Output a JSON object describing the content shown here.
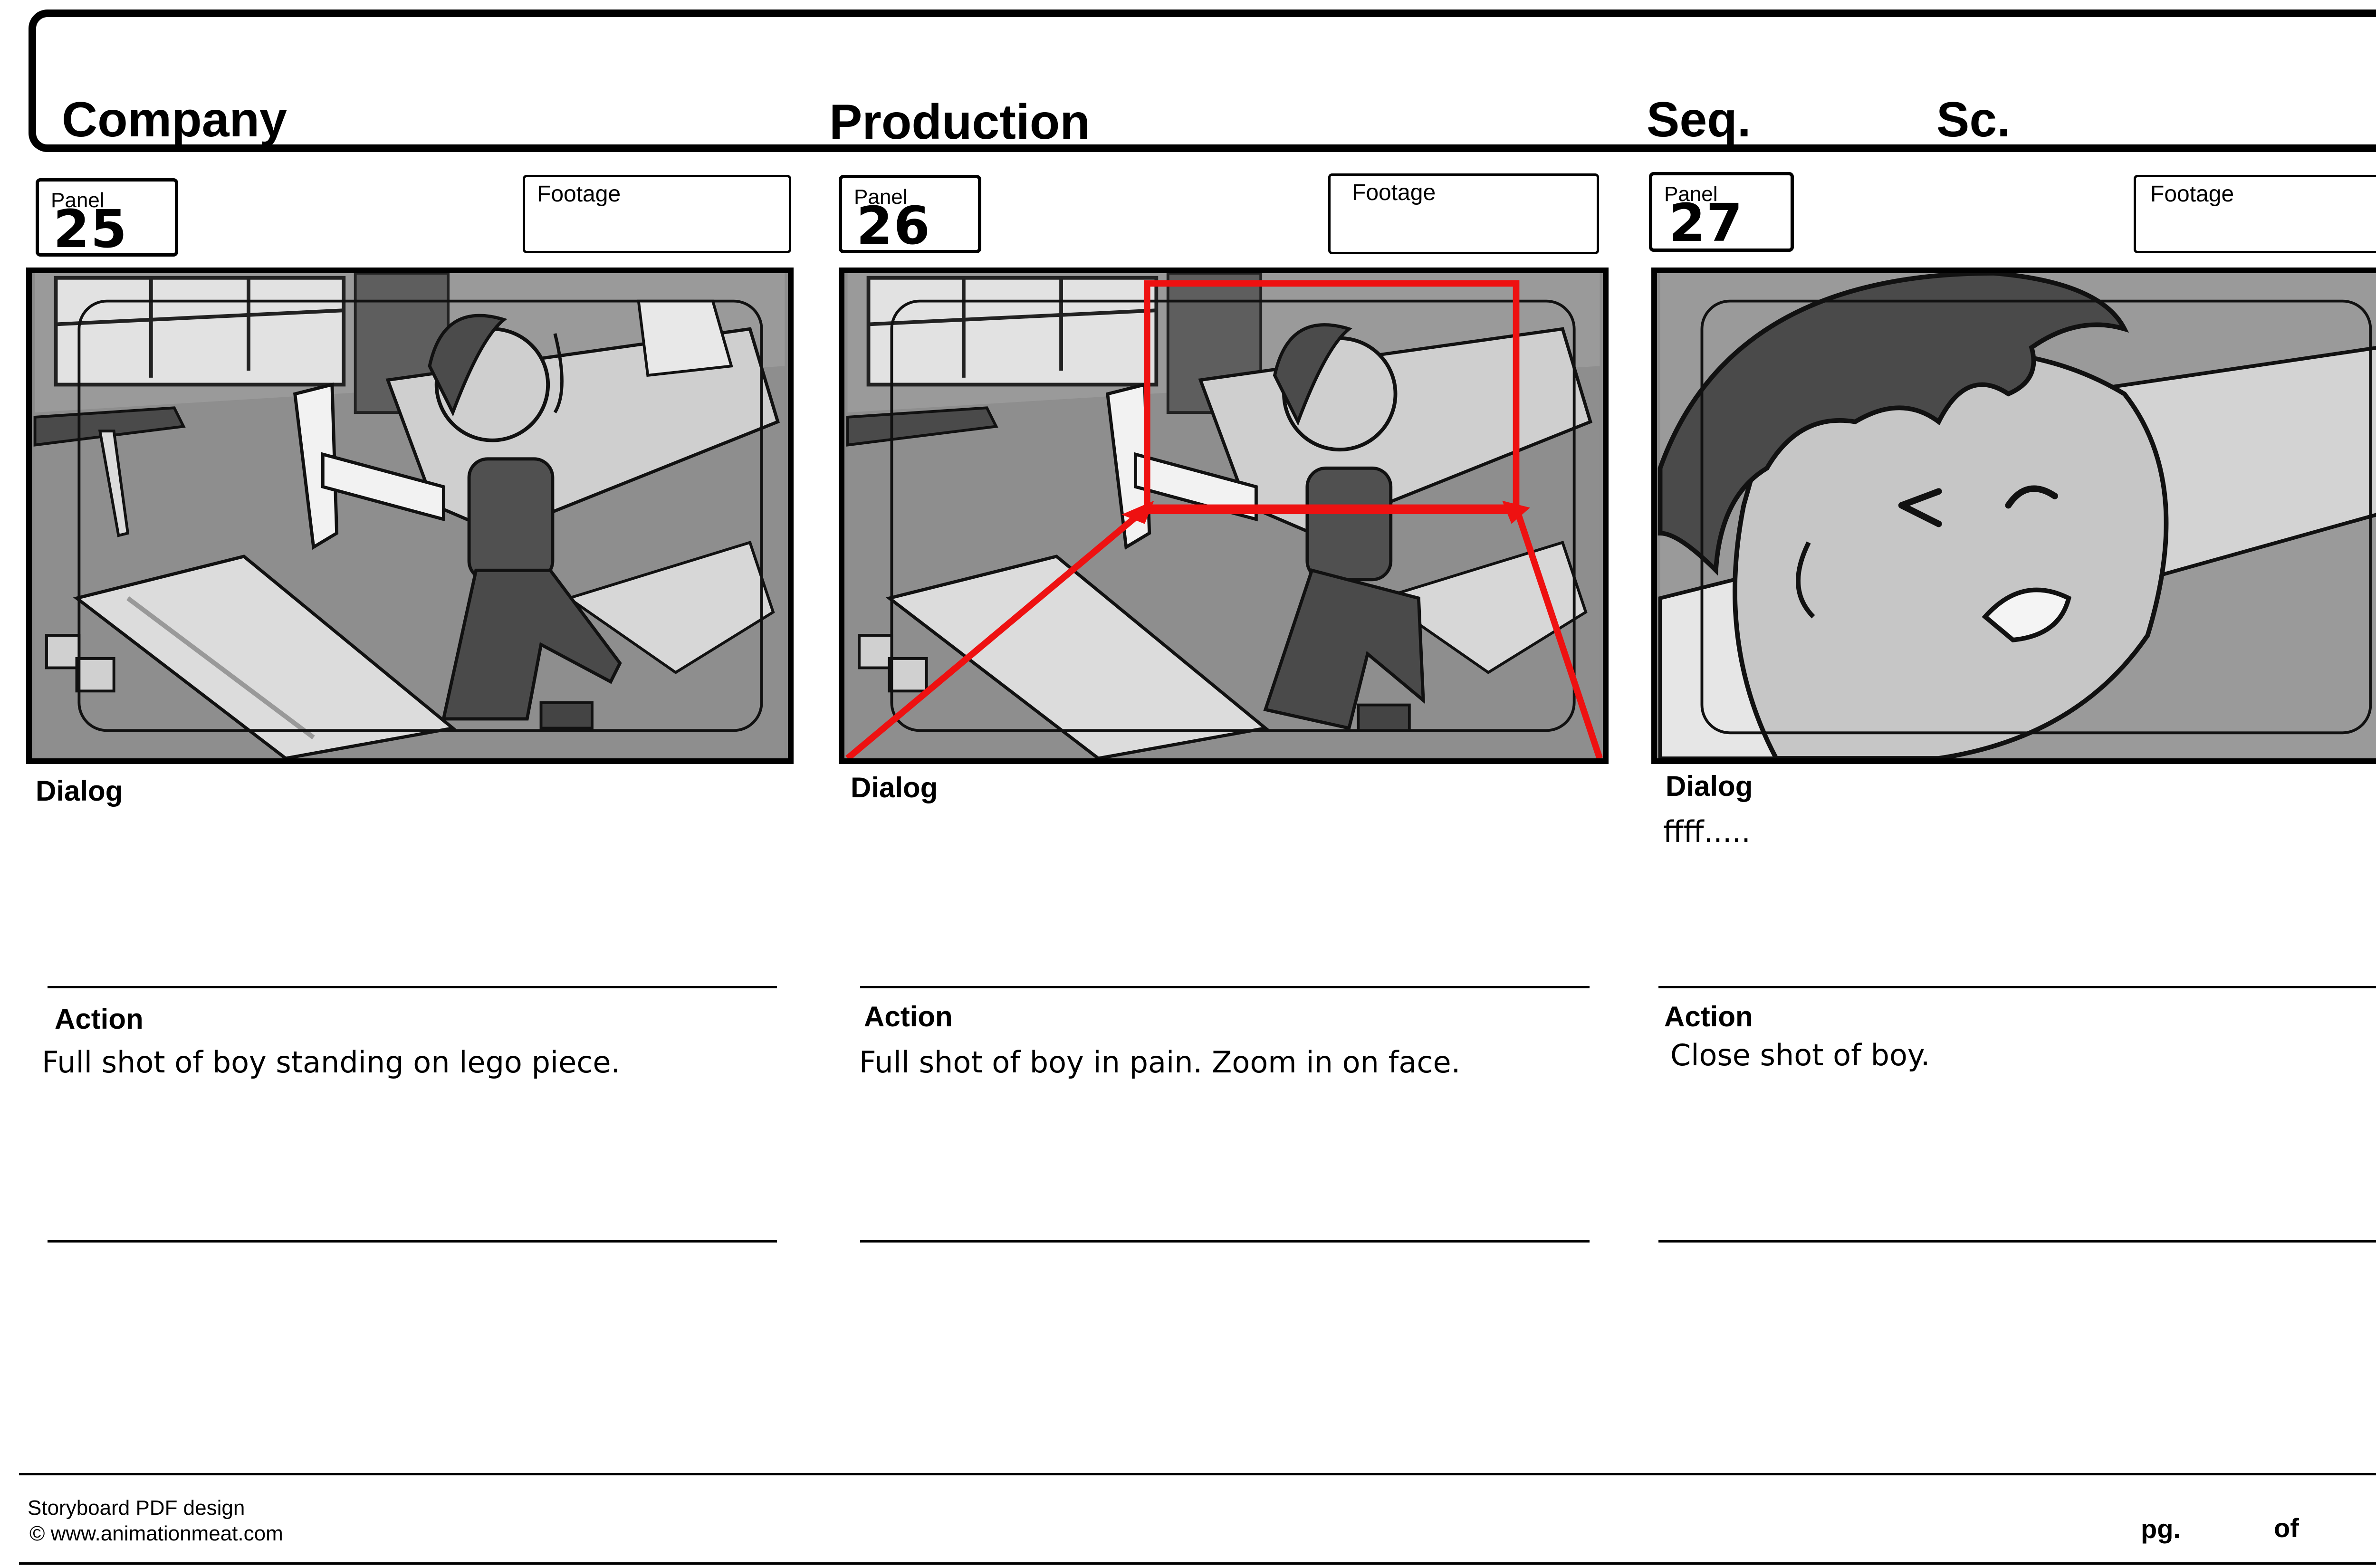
{
  "header": {
    "company_label": "Company",
    "production_label": "Production",
    "seq_label": "Seq.",
    "sc_label": "Sc."
  },
  "panels": [
    {
      "panel_label": "Panel",
      "number": "25",
      "footage_label": "Footage",
      "dialog_label": "Dialog",
      "dialog": "",
      "action_label": "Action",
      "action": "Full shot of boy standing on lego piece."
    },
    {
      "panel_label": "Panel",
      "number": "26",
      "footage_label": "Footage",
      "dialog_label": "Dialog",
      "dialog": "",
      "action_label": "Action",
      "action": "Full shot of boy in pain. Zoom in on face."
    },
    {
      "panel_label": "Panel",
      "number": "27",
      "footage_label": "Footage",
      "dialog_label": "Dialog",
      "dialog": "ffff.....",
      "action_label": "Action",
      "action": "Close shot of boy."
    }
  ],
  "footer": {
    "credit_line1": "Storyboard PDF design",
    "credit_line2": "© www.animationmeat.com",
    "page_label": "pg.",
    "of_label": "of"
  },
  "colors": {
    "camera_move": "#ee1111",
    "frame_bg": "#8c8c8c"
  }
}
